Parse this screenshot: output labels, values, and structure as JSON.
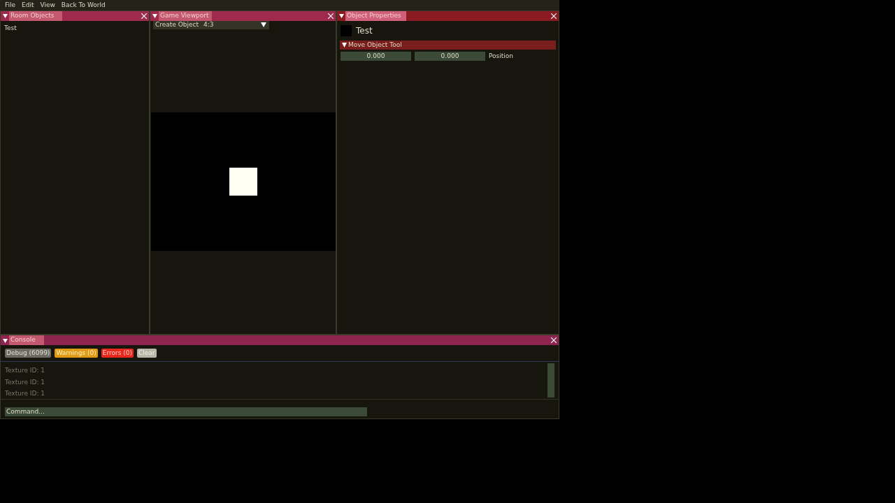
{
  "menu": [
    "File",
    "Edit",
    "View",
    "Back To World"
  ],
  "room_objects": {
    "title": "Room Objects",
    "items": [
      {
        "label": "Test",
        "selected": false
      }
    ]
  },
  "game_viewport": {
    "title": "Game Viewport",
    "create_object": "Create Object",
    "aspect": "4:3"
  },
  "object_properties": {
    "title": "Object Properties",
    "name": "Test",
    "section": "Move Object Tool",
    "fields": [
      "0.000",
      "0.000"
    ],
    "field_label": "Position"
  },
  "console": {
    "title": "Console",
    "filters": [
      {
        "kind": "debug",
        "label": "Debug (6099)"
      },
      {
        "kind": "warning",
        "label": "Warnings (0)"
      },
      {
        "kind": "error",
        "label": "Errors (0)"
      },
      {
        "kind": "clear",
        "label": "Clear"
      }
    ],
    "lines": [
      "Texture ID: 1",
      "Texture ID: 1",
      "Texture ID: 1"
    ],
    "command": {
      "placeholder": "Command..."
    }
  }
}
